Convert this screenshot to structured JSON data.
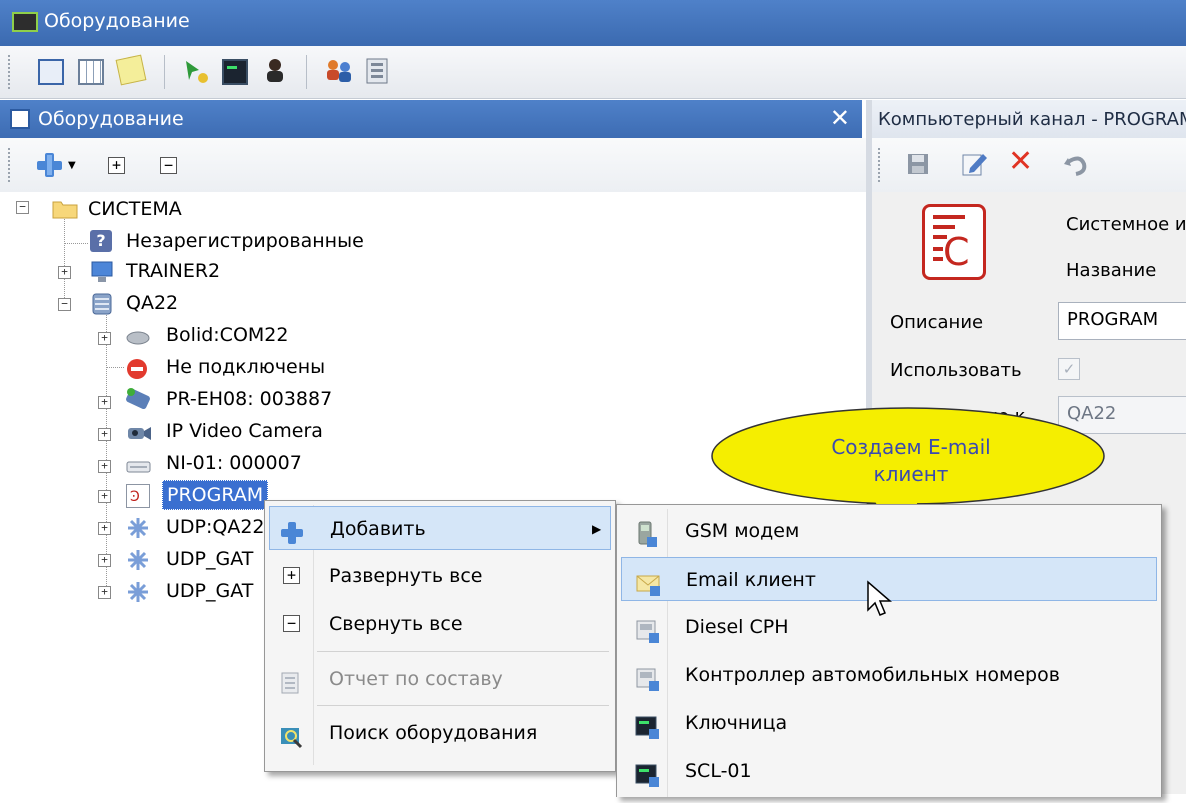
{
  "window": {
    "title": "Оборудование"
  },
  "left_panel": {
    "title": "Оборудование",
    "close_symbol": "✕"
  },
  "tree_toolbar": {
    "expand_symbol": "+",
    "collapse_symbol": "−"
  },
  "tree": {
    "root": "СИСТЕМА",
    "items": [
      "Незарегистрированные",
      "TRAINER2",
      "QA22",
      "Bolid:COM22",
      "Не подключены",
      "PR-EH08: 003887",
      "IP Video Camera",
      "NI-01: 000007",
      "PROGRAM",
      "UDP:QA22",
      "UDP_GAT",
      "UDP_GAT"
    ]
  },
  "right_panel": {
    "title": "Компьютерный канал - PROGRAM",
    "fields": {
      "system_label": "Системное имя",
      "name_label": "Название",
      "description_label": "Описание",
      "description_value": "PROGRAM",
      "use_label": "Использовать",
      "check_mark": "✓",
      "connected_label": "Подключено к",
      "connected_value": "QA22"
    }
  },
  "context_menu": {
    "items": [
      "Добавить",
      "Развернуть все",
      "Свернуть все",
      "Отчет по составу",
      "Поиск оборудования"
    ],
    "submenu_arrow": "▶"
  },
  "submenu": {
    "items": [
      "GSM модем",
      "Email клиент",
      "Diesel CPH",
      "Контроллер автомобильных номеров",
      "Ключница",
      "SCL-01"
    ]
  },
  "callout": {
    "text": "Создаем E-mail клиент"
  },
  "colors": {
    "header_blue": "#3f6fb6",
    "highlight": "#d5e6f8",
    "callout_yellow": "#f5ee00"
  }
}
